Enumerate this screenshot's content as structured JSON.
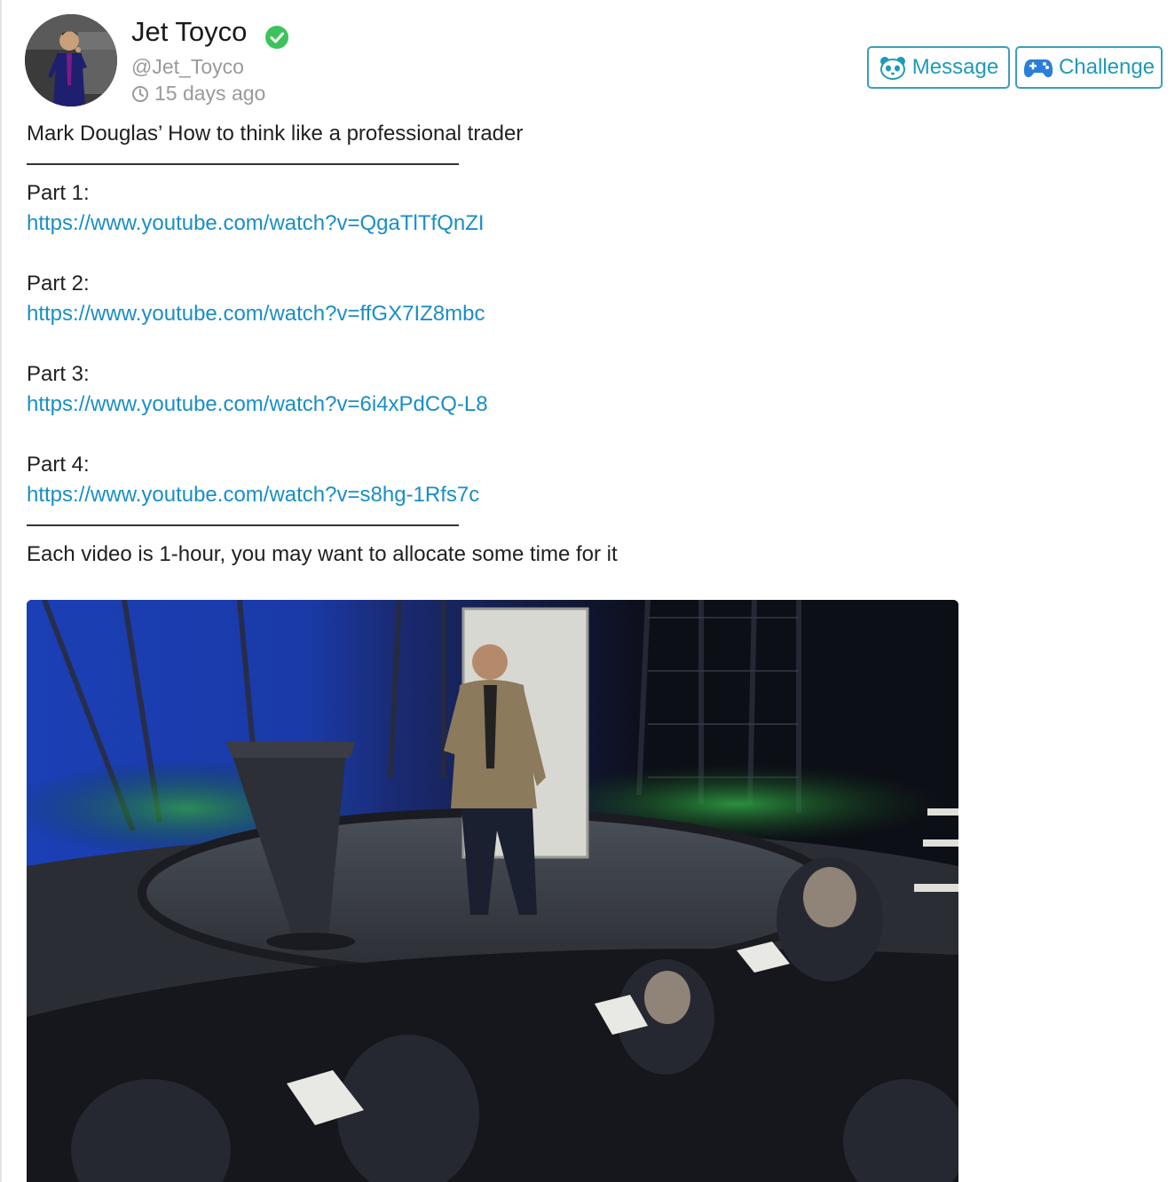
{
  "author": {
    "name": "Jet Toyco",
    "handle": "@Jet_Toyco",
    "time_ago": "15 days ago",
    "verified": true
  },
  "actions": {
    "message_label": "Message",
    "challenge_label": "Challenge"
  },
  "post": {
    "title": "Mark Douglas’ How to think like a professional trader",
    "parts": [
      {
        "label": "Part 1:",
        "url": "https://www.youtube.com/watch?v=QgaTlTfQnZI"
      },
      {
        "label": "Part 2:",
        "url": "https://www.youtube.com/watch?v=ffGX7IZ8mbc"
      },
      {
        "label": "Part 3:",
        "url": "https://www.youtube.com/watch?v=6i4xPdCQ-L8"
      },
      {
        "label": "Part 4:",
        "url": "https://www.youtube.com/watch?v=s8hg-1Rfs7c"
      }
    ],
    "footer_note": "Each video is 1-hour, you may want to allocate some time for it"
  },
  "icons": {
    "verified": "check-circle-icon",
    "time": "clock-icon",
    "message": "panda-icon",
    "challenge": "gamepad-icon"
  },
  "colors": {
    "accent": "#1f9ab8",
    "link": "#1a8ec4",
    "verified": "#3cc35c",
    "muted": "#9a9a9a"
  }
}
